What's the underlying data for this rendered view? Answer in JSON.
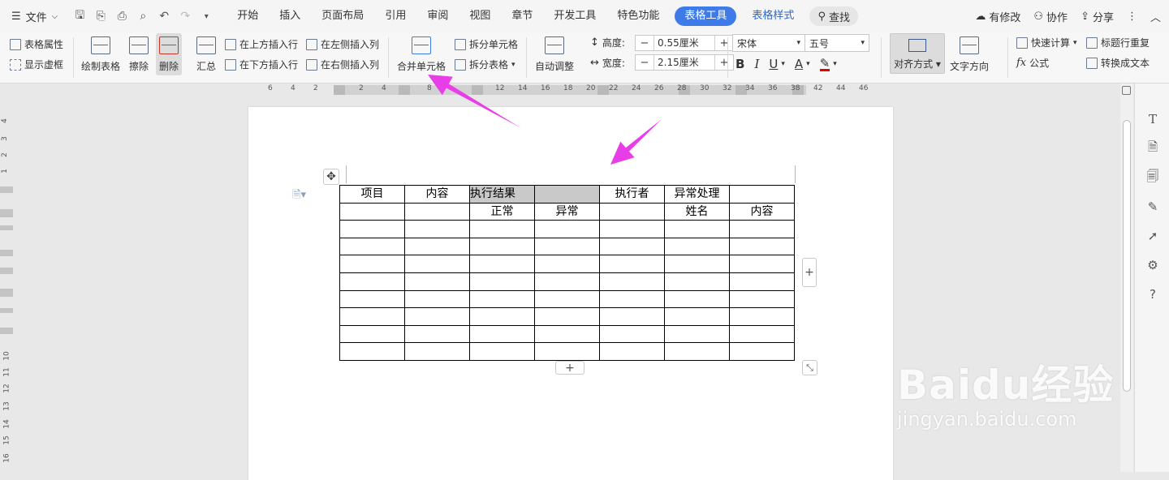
{
  "menubar": {
    "file_label": "文件",
    "tabs": [
      "开始",
      "插入",
      "页面布局",
      "引用",
      "审阅",
      "视图",
      "章节",
      "开发工具",
      "特色功能"
    ],
    "active_tab": "表格工具",
    "extra_tab": "表格样式",
    "search_label": "查找",
    "right": {
      "modified": "有修改",
      "collab": "协作",
      "share": "分享"
    }
  },
  "ribbon": {
    "table_props": "表格属性",
    "show_grid": "显示虚框",
    "draw_table": "绘制表格",
    "erase": "擦除",
    "delete": "删除",
    "summary": "汇总",
    "insert_above": "在上方插入行",
    "insert_below": "在下方插入行",
    "insert_left": "在左侧插入列",
    "insert_right": "在右侧插入列",
    "merge_cells": "合并单元格",
    "split_cells": "拆分单元格",
    "split_table": "拆分表格",
    "auto_fit": "自动调整",
    "height_label": "高度:",
    "height_value": "0.55厘米",
    "width_label": "宽度:",
    "width_value": "2.15厘米",
    "font_name": "宋体",
    "font_size": "五号",
    "align": "对齐方式",
    "text_dir": "文字方向",
    "quick_calc": "快速计算",
    "repeat_header": "标题行重复",
    "formula": "公式",
    "to_text": "转换成文本"
  },
  "ruler_h": [
    "6",
    "4",
    "2",
    "2",
    "4",
    "8",
    "12",
    "14",
    "16",
    "18",
    "20",
    "22",
    "24",
    "26",
    "28",
    "30",
    "32",
    "34",
    "36",
    "38",
    "42",
    "44",
    "46"
  ],
  "ruler_v": [
    "4",
    "3",
    "2",
    "1",
    "10",
    "11",
    "12",
    "13",
    "14",
    "15",
    "16"
  ],
  "table": {
    "rows": [
      [
        "项目",
        "内容",
        "执行结果",
        "",
        "执行者",
        "异常处理",
        ""
      ],
      [
        "",
        "",
        "正常",
        "异常",
        "",
        "姓名",
        "内容"
      ],
      [
        "",
        "",
        "",
        "",
        "",
        "",
        ""
      ],
      [
        "",
        "",
        "",
        "",
        "",
        "",
        ""
      ],
      [
        "",
        "",
        "",
        "",
        "",
        "",
        ""
      ],
      [
        "",
        "",
        "",
        "",
        "",
        "",
        ""
      ],
      [
        "",
        "",
        "",
        "",
        "",
        "",
        ""
      ],
      [
        "",
        "",
        "",
        "",
        "",
        "",
        ""
      ],
      [
        "",
        "",
        "",
        "",
        "",
        "",
        ""
      ],
      [
        "",
        "",
        "",
        "",
        "",
        "",
        ""
      ]
    ],
    "selected_cells": [
      [
        0,
        2
      ],
      [
        0,
        3
      ]
    ]
  },
  "annotation_color": "#e83ee8",
  "watermark": {
    "logo": "Baidu经验",
    "url": "jingyan.baidu.com"
  }
}
